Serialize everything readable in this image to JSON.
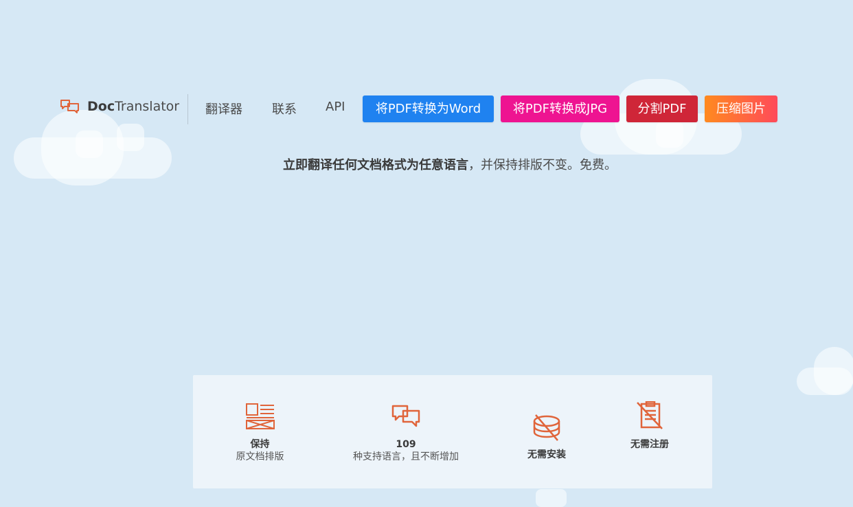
{
  "logo": {
    "brand_bold": "Doc",
    "brand_rest": "Translator",
    "icon": "chat-bubbles-icon"
  },
  "nav": {
    "translator": "翻译器",
    "contact": "联系",
    "api": "API"
  },
  "buttons": {
    "pdf_to_word": {
      "label": "将PDF转换为Word",
      "color": "#1f82f0"
    },
    "pdf_to_jpg": {
      "label": "将PDF转换成JPG",
      "color": "#ee1491"
    },
    "split_pdf": {
      "label": "分割PDF",
      "color": "#cf2638"
    },
    "compress_image": {
      "label": "压缩图片",
      "color_start": "#ff8a1f",
      "color_end": "#ff4a5a"
    }
  },
  "tagline": {
    "bold": "立即翻译任何文档格式为任意语言",
    "rest": "，并保持排版不变。免费。"
  },
  "features": [
    {
      "icon": "layout-icon",
      "line1": "保持",
      "line2": "原文档排版"
    },
    {
      "icon": "chat-bubbles-icon",
      "line1": "109",
      "line2": "种支持语言，且不断增加"
    },
    {
      "icon": "no-install-icon",
      "line1": "无需安装",
      "line2": ""
    },
    {
      "icon": "no-register-icon",
      "line1": "无需注册",
      "line2": ""
    }
  ],
  "accent_color": "#e0643a"
}
